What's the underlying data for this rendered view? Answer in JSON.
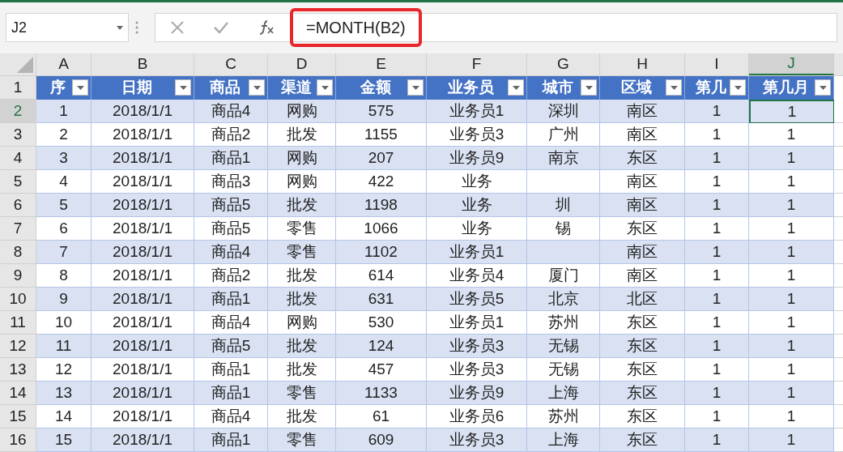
{
  "name_box": "J2",
  "formula": "=MONTH(B2)",
  "formula_highlighted": true,
  "columns": [
    {
      "letter": "A",
      "selected": false
    },
    {
      "letter": "B",
      "selected": false
    },
    {
      "letter": "C",
      "selected": false
    },
    {
      "letter": "D",
      "selected": false
    },
    {
      "letter": "E",
      "selected": false
    },
    {
      "letter": "F",
      "selected": false
    },
    {
      "letter": "G",
      "selected": false
    },
    {
      "letter": "H",
      "selected": false
    },
    {
      "letter": "I",
      "selected": false
    },
    {
      "letter": "J",
      "selected": true
    }
  ],
  "header_row": {
    "number": "1",
    "labels": [
      "序",
      "日期",
      "商品",
      "渠道",
      "金额",
      "业务员",
      "城市",
      "区域",
      "第几",
      "第几月"
    ]
  },
  "rows": [
    {
      "number": "2",
      "selected": true,
      "banded": true,
      "cells": [
        "1",
        "2018/1/1",
        "商品4",
        "网购",
        "575",
        "业务员1",
        "深圳",
        "南区",
        "1",
        "1"
      ]
    },
    {
      "number": "3",
      "selected": false,
      "banded": false,
      "cells": [
        "2",
        "2018/1/1",
        "商品2",
        "批发",
        "1155",
        "业务员3",
        "广州",
        "南区",
        "1",
        "1"
      ]
    },
    {
      "number": "4",
      "selected": false,
      "banded": true,
      "cells": [
        "3",
        "2018/1/1",
        "商品1",
        "网购",
        "207",
        "业务员9",
        "南京",
        "东区",
        "1",
        "1"
      ]
    },
    {
      "number": "5",
      "selected": false,
      "banded": false,
      "cells": [
        "4",
        "2018/1/1",
        "商品3",
        "网购",
        "422",
        "业务",
        null,
        "南区",
        "1",
        "1"
      ]
    },
    {
      "number": "6",
      "selected": false,
      "banded": true,
      "cells": [
        "5",
        "2018/1/1",
        "商品5",
        "批发",
        "1198",
        "业务",
        "圳",
        "南区",
        "1",
        "1"
      ]
    },
    {
      "number": "7",
      "selected": false,
      "banded": false,
      "cells": [
        "6",
        "2018/1/1",
        "商品5",
        "零售",
        "1066",
        "业务",
        "锡",
        "东区",
        "1",
        "1"
      ]
    },
    {
      "number": "8",
      "selected": false,
      "banded": true,
      "cells": [
        "7",
        "2018/1/1",
        "商品4",
        "零售",
        "1102",
        "业务员1",
        null,
        "南区",
        "1",
        "1"
      ]
    },
    {
      "number": "9",
      "selected": false,
      "banded": false,
      "cells": [
        "8",
        "2018/1/1",
        "商品2",
        "批发",
        "614",
        "业务员4",
        "厦门",
        "南区",
        "1",
        "1"
      ]
    },
    {
      "number": "10",
      "selected": false,
      "banded": true,
      "cells": [
        "9",
        "2018/1/1",
        "商品1",
        "批发",
        "631",
        "业务员5",
        "北京",
        "北区",
        "1",
        "1"
      ]
    },
    {
      "number": "11",
      "selected": false,
      "banded": false,
      "cells": [
        "10",
        "2018/1/1",
        "商品4",
        "网购",
        "530",
        "业务员1",
        "苏州",
        "东区",
        "1",
        "1"
      ]
    },
    {
      "number": "12",
      "selected": false,
      "banded": true,
      "cells": [
        "11",
        "2018/1/1",
        "商品5",
        "批发",
        "124",
        "业务员3",
        "无锡",
        "东区",
        "1",
        "1"
      ]
    },
    {
      "number": "13",
      "selected": false,
      "banded": false,
      "cells": [
        "12",
        "2018/1/1",
        "商品1",
        "批发",
        "457",
        "业务员3",
        "无锡",
        "东区",
        "1",
        "1"
      ]
    },
    {
      "number": "14",
      "selected": false,
      "banded": true,
      "cells": [
        "13",
        "2018/1/1",
        "商品1",
        "零售",
        "1133",
        "业务员9",
        "上海",
        "东区",
        "1",
        "1"
      ]
    },
    {
      "number": "15",
      "selected": false,
      "banded": false,
      "cells": [
        "14",
        "2018/1/1",
        "商品4",
        "批发",
        "61",
        "业务员6",
        "苏州",
        "东区",
        "1",
        "1"
      ]
    },
    {
      "number": "16",
      "selected": false,
      "banded": true,
      "cells": [
        "15",
        "2018/1/1",
        "商品1",
        "零售",
        "609",
        "业务员3",
        "上海",
        "东区",
        "1",
        "1"
      ]
    }
  ]
}
